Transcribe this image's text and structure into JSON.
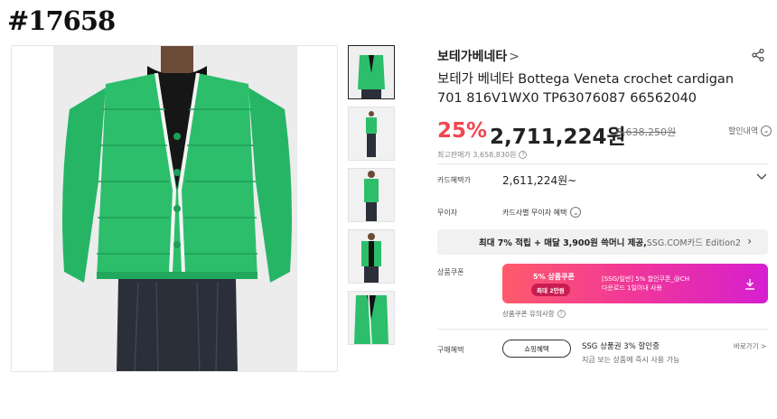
{
  "post_tag": "#17658",
  "gallery": {
    "thumbnails": [
      "thumb-front-cardigan",
      "thumb-full-body",
      "thumb-side-view",
      "thumb-open-front",
      "thumb-detail"
    ],
    "cardigan_color": "#26b565"
  },
  "product": {
    "brand": "보테가베네타",
    "brand_chevron": ">",
    "title": "보테가 베네타 Bottega Veneta crochet cardigan 701 816V1WX0 TP63076087 66562040",
    "discount": "25%",
    "price": "2,711,224원",
    "original_price": "3,638,250원",
    "price_history_label": "할인내역",
    "max_price_label": "최고판매가 3,658,830원",
    "accent_color": "#f2464f"
  },
  "benefits": {
    "card_label": "카드혜택가",
    "card_value": "2,611,224원~",
    "interest_label": "무이자",
    "interest_value": "카드사별 무이자 혜택",
    "banner_bold": "최대 7% 적립 + 매달 3,900원 쓱머니 제공,",
    "banner_muted": " SSG.COM카드 Edition2",
    "coupon_label": "상품쿠폰",
    "coupon_title": "5% 상품쿠폰",
    "coupon_max": "최대 2만원",
    "coupon_desc1": "[SSG/일반] 5% 할인쿠폰_@CH",
    "coupon_desc2": "다운로드 1일이내 사용",
    "coupon_note": "상품쿠폰 유의사항",
    "purchase_label": "구매혜택",
    "shopping_button": "쇼핑혜택",
    "purchase_title": "SSG 상품권 3% 할인중",
    "purchase_sub": "지금 보는 상품에 즉시 사용 가능",
    "see_more": "바로가기 >"
  }
}
